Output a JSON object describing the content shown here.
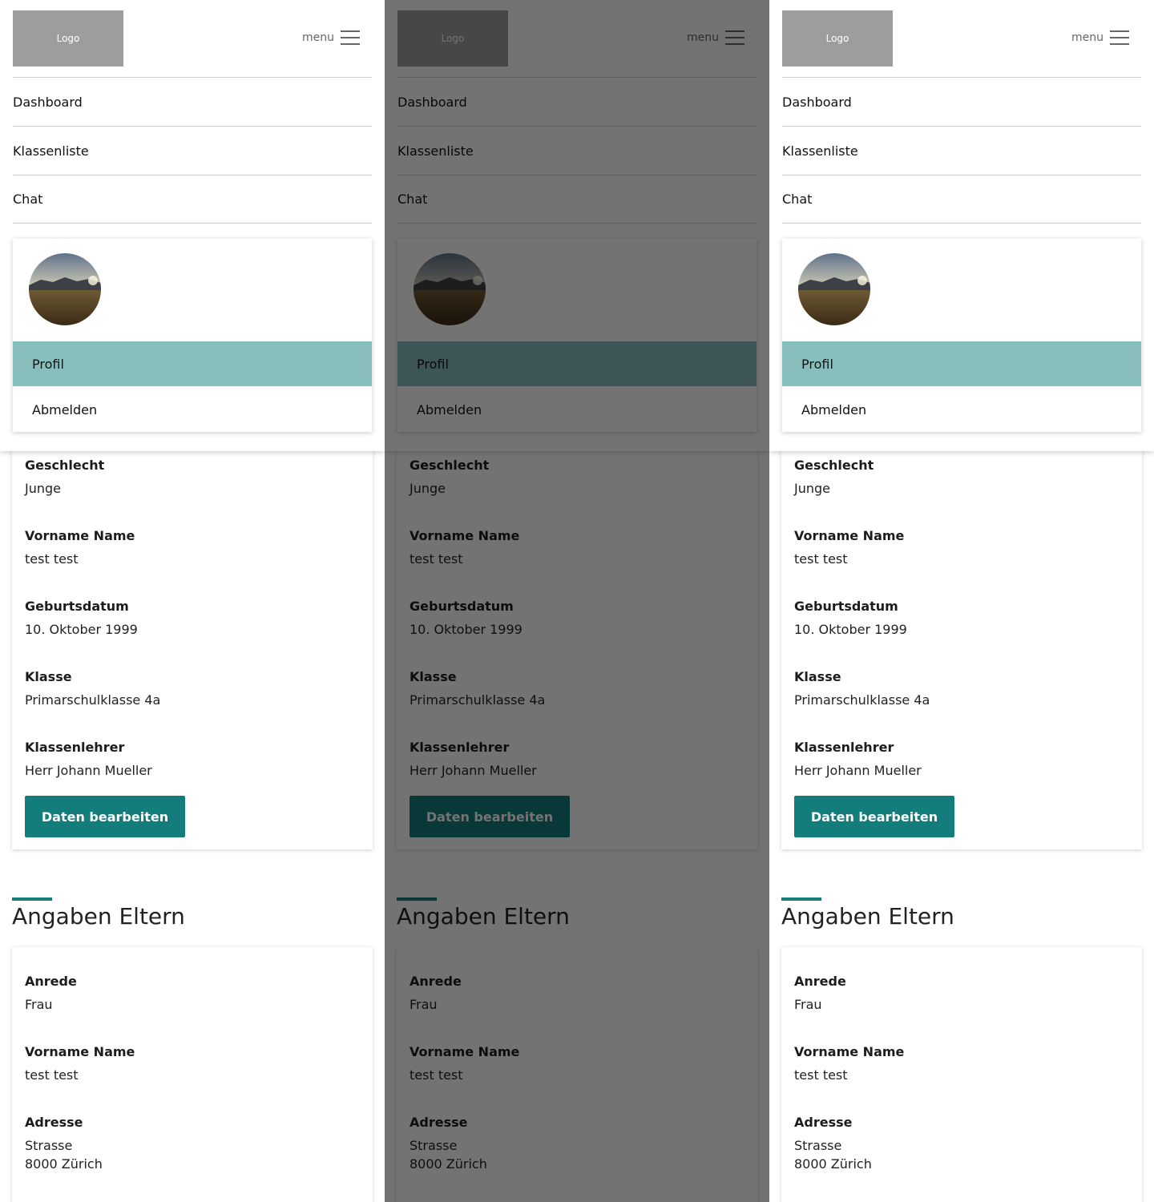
{
  "header": {
    "logo_label": "Logo",
    "menu_label": "menu"
  },
  "nav": {
    "items": [
      "Dashboard",
      "Klassenliste",
      "Chat"
    ]
  },
  "dropdown": {
    "profile_label": "Profil",
    "logout_label": "Abmelden"
  },
  "student": {
    "fields": [
      {
        "label": "Geschlecht",
        "value": "Junge"
      },
      {
        "label": "Vorname Name",
        "value": "test test"
      },
      {
        "label": "Geburtsdatum",
        "value": "10. Oktober 1999"
      },
      {
        "label": "Klasse",
        "value": "Primarschulklasse 4a"
      },
      {
        "label": "Klassenlehrer",
        "value": "Herr Johann Mueller"
      }
    ],
    "edit_button": "Daten bearbeiten"
  },
  "parents": {
    "title": "Angaben Eltern",
    "fields": [
      {
        "label": "Anrede",
        "value": "Frau"
      },
      {
        "label": "Vorname Name",
        "value": "test test"
      },
      {
        "label": "Adresse",
        "value": "Strasse",
        "value2": "8000 Zürich"
      }
    ]
  },
  "colors": {
    "accent": "#127d7b",
    "highlight": "#88bfbc",
    "logo_bg": "#9d9d9d"
  }
}
